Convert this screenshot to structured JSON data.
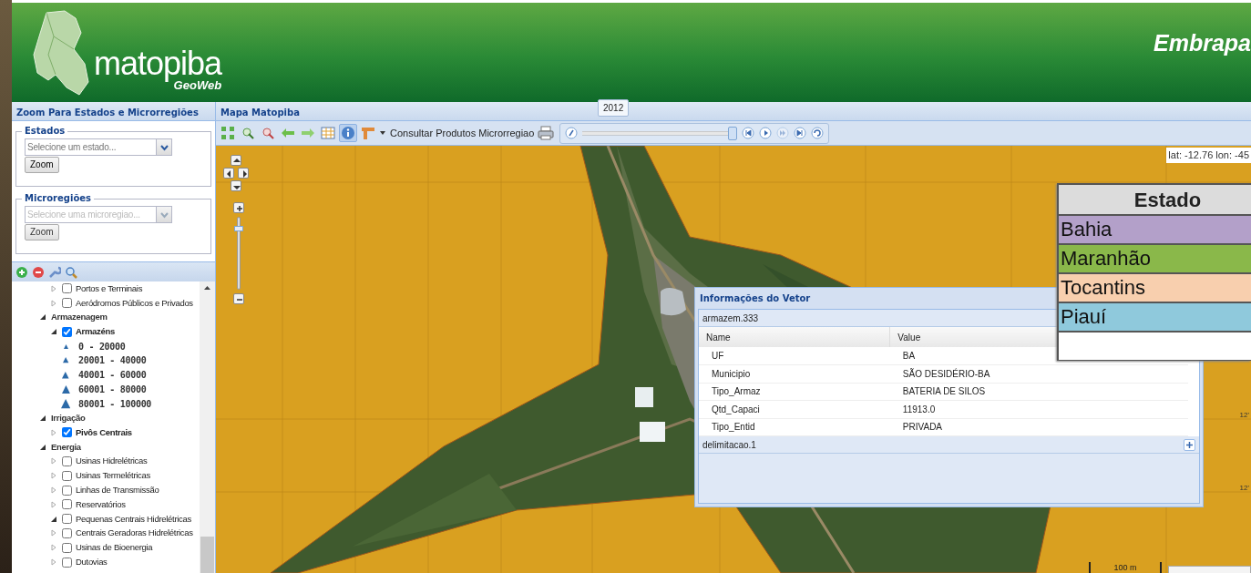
{
  "header": {
    "logo_text": "matopiba",
    "logo_subtitle": "GeoWeb",
    "brand": "Embrapa"
  },
  "left_panel": {
    "title": "Zoom Para Estados e Microrregiões",
    "fieldsets": [
      {
        "legend": "Estados",
        "placeholder": "Selecione um estado...",
        "button": "Zoom",
        "disabled": false
      },
      {
        "legend": "Microregiões",
        "placeholder": "Selecione uma microregiao...",
        "button": "Zoom",
        "disabled": true
      }
    ],
    "tools": [
      {
        "kind": "add"
      },
      {
        "kind": "remove"
      },
      {
        "kind": "wrench"
      },
      {
        "kind": "search"
      }
    ],
    "tree": {
      "partial_children": [
        {
          "kind": "layer",
          "label": "Portos e Terminais",
          "checked": false,
          "expanded": false
        },
        {
          "kind": "layer",
          "label": "Aeródromos Públicos e Privados",
          "checked": false,
          "expanded": false
        }
      ],
      "items": [
        {
          "kind": "group",
          "label": "Armazenagem",
          "expanded": true,
          "children": [
            {
              "kind": "layer",
              "label": "Armazéns",
              "checked": true,
              "expanded": true,
              "children": [
                {
                  "kind": "legend",
                  "label": "0 - 20000"
                },
                {
                  "kind": "legend",
                  "label": "20001 - 40000"
                },
                {
                  "kind": "legend",
                  "label": "40001 - 60000"
                },
                {
                  "kind": "legend",
                  "label": "60001 - 80000"
                },
                {
                  "kind": "legend",
                  "label": "80001 - 100000"
                }
              ]
            }
          ]
        },
        {
          "kind": "group",
          "label": "Irrigação",
          "expanded": true,
          "children": [
            {
              "kind": "layer",
              "label": "Pivôs Centrais",
              "checked": true,
              "expanded": false
            }
          ]
        },
        {
          "kind": "group",
          "label": "Energia",
          "expanded": true,
          "children": [
            {
              "kind": "layer",
              "label": "Usinas Hidrelétricas",
              "checked": false,
              "expanded": false
            },
            {
              "kind": "layer",
              "label": "Usinas Termelétricas",
              "checked": false,
              "expanded": false
            },
            {
              "kind": "layer",
              "label": "Linhas de Transmissão",
              "checked": false,
              "expanded": false
            },
            {
              "kind": "layer",
              "label": "Reservatórios",
              "checked": false,
              "expanded": false
            },
            {
              "kind": "layer",
              "label": "Pequenas Centrais Hidrelétricas",
              "checked": false,
              "expanded": true
            },
            {
              "kind": "layer",
              "label": "Centrais Geradoras Hidrelétricas",
              "checked": false,
              "expanded": false
            },
            {
              "kind": "layer",
              "label": "Usinas de Bioenergia",
              "checked": false,
              "expanded": false
            },
            {
              "kind": "layer",
              "label": "Dutovias",
              "checked": false,
              "expanded": false
            }
          ]
        }
      ]
    }
  },
  "map_panel": {
    "title": "Mapa Matopiba",
    "tooltip": "2012",
    "tools": [
      {
        "kind": "extent",
        "selected": false
      },
      {
        "kind": "zoom-in",
        "selected": false
      },
      {
        "kind": "zoom-out",
        "selected": false
      },
      {
        "kind": "back",
        "selected": false
      },
      {
        "kind": "forward",
        "selected": false
      },
      {
        "kind": "table",
        "selected": false
      },
      {
        "kind": "info",
        "selected": true
      },
      {
        "kind": "measure",
        "selected": false
      }
    ],
    "query_button": "Consultar Produtos Microrregiao",
    "timeline": {
      "level": 0.97,
      "buttons": [
        {
          "kind": "first",
          "disabled": false
        },
        {
          "kind": "play",
          "disabled": false
        },
        {
          "kind": "fast-forward",
          "disabled": true
        },
        {
          "kind": "last",
          "disabled": false
        },
        {
          "kind": "loop",
          "disabled": false
        }
      ]
    }
  },
  "map": {
    "coordinates": "lat: -12.76 lon: -45",
    "grid_labels": [
      "12'",
      "12'"
    ],
    "scale": "100 m",
    "zoom": {
      "level": 0.85
    },
    "popup": {
      "title": "Informações do Vetor",
      "groups": [
        {
          "label": "armazem.333",
          "expanded": true,
          "columns": [
            "Name",
            "Value"
          ],
          "rows": [
            [
              "UF",
              "BA"
            ],
            [
              "Municipio",
              "SÃO DESIDÉRIO-BA"
            ],
            [
              "Tipo_Armaz",
              "BATERIA DE SILOS"
            ],
            [
              "Qtd_Capaci",
              "11913.0"
            ],
            [
              "Tipo_Entid",
              "PRIVADA"
            ]
          ]
        },
        {
          "label": "delimitacao.1",
          "expanded": false
        }
      ]
    },
    "legend": {
      "title": "Estado",
      "rows": [
        {
          "label": "Bahia",
          "color": "#b3a0c9"
        },
        {
          "label": "Maranhão",
          "color": "#8ab84a"
        },
        {
          "label": "Tocantins",
          "color": "#f8cfae"
        },
        {
          "label": "Piauí",
          "color": "#8fc9dc"
        }
      ]
    }
  }
}
